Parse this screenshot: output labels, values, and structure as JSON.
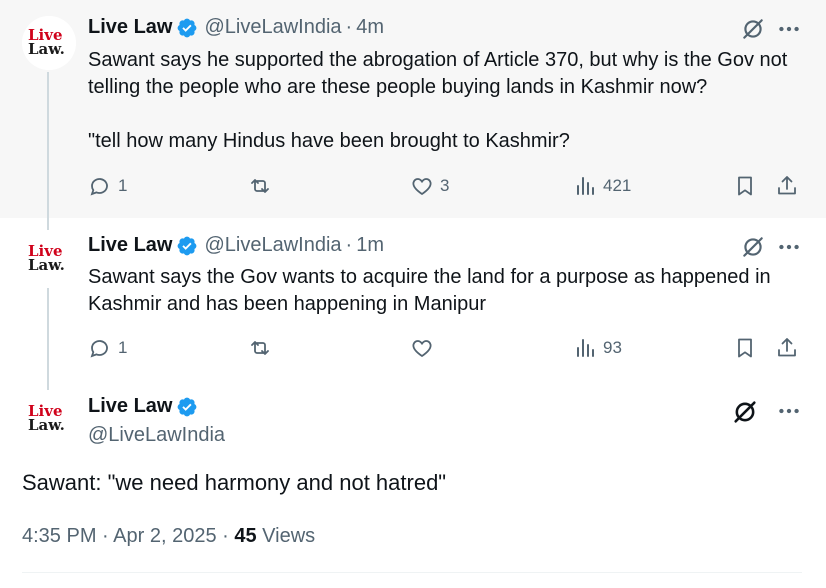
{
  "tweets": [
    {
      "author_name": "Live Law",
      "handle": "@LiveLawIndia",
      "separator": "·",
      "time": "4m",
      "lines": [
        "Sawant says he supported the abrogation of Article 370, but why is the Gov not telling the people who are these people buying lands in Kashmir now?",
        "\"tell how many Hindus have been brought to Kashmir?"
      ],
      "replies": "1",
      "reposts": "",
      "likes": "3",
      "views": "421"
    },
    {
      "author_name": "Live Law",
      "handle": "@LiveLawIndia",
      "separator": "·",
      "time": "1m",
      "lines": [
        "Sawant says the Gov wants to acquire the land for a purpose as happened in Kashmir and has been happening in Manipur"
      ],
      "replies": "1",
      "reposts": "",
      "likes": "",
      "views": "93"
    },
    {
      "author_name": "Live Law",
      "handle": "@LiveLawIndia",
      "text": "Sawant: \"we need harmony and not hatred\"",
      "timestamp": "4:35 PM · Apr 2, 2025",
      "meta_separator": "·",
      "views_count": "45",
      "views_label": "Views"
    }
  ],
  "avatar_logo": {
    "line1": "Live",
    "line2": "Law."
  },
  "colors": {
    "verified": "#1d9bf0",
    "logo_red": "#d0021b",
    "muted": "#536471"
  },
  "icons": [
    "verified-badge-icon",
    "grok-icon",
    "more-icon",
    "reply-icon",
    "repost-icon",
    "like-icon",
    "views-icon",
    "bookmark-icon",
    "share-icon"
  ]
}
